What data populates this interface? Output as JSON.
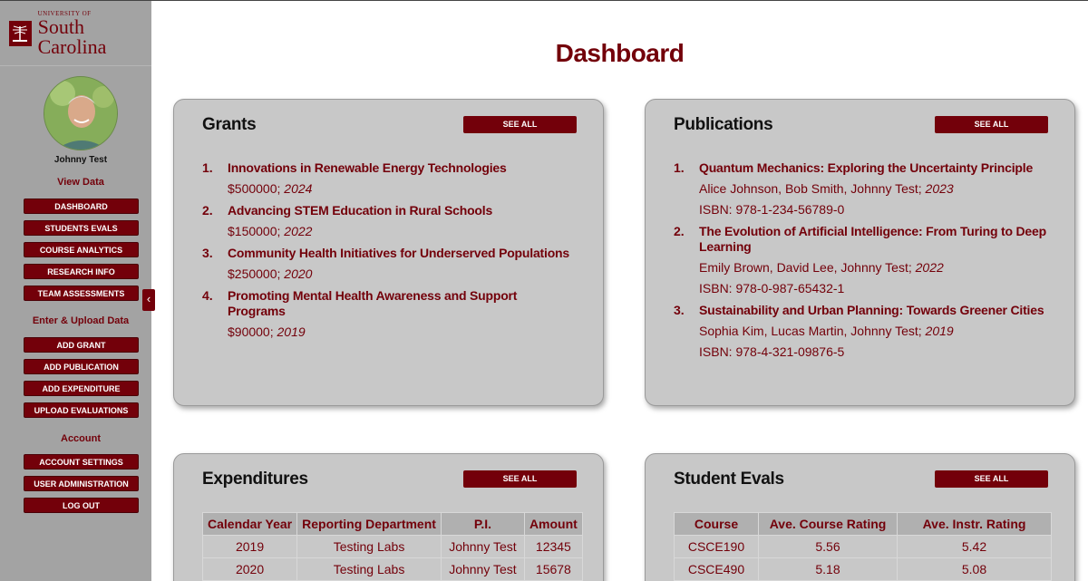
{
  "brand": {
    "sub": "UNIVERSITY OF",
    "main": "South Carolina"
  },
  "user": {
    "name": "Johnny Test"
  },
  "sidebar": {
    "view_data_label": "View Data",
    "view_items": [
      "DASHBOARD",
      "STUDENTS EVALS",
      "COURSE ANALYTICS",
      "RESEARCH INFO",
      "TEAM ASSESSMENTS"
    ],
    "enter_label": "Enter & Upload Data",
    "enter_items": [
      "ADD GRANT",
      "ADD PUBLICATION",
      "ADD EXPENDITURE",
      "UPLOAD EVALUATIONS"
    ],
    "account_label": "Account",
    "account_items": [
      "ACCOUNT SETTINGS",
      "USER ADMINISTRATION",
      "LOG OUT"
    ],
    "collapse_glyph": "‹"
  },
  "page": {
    "title": "Dashboard"
  },
  "see_all": "SEE ALL",
  "grants": {
    "title": "Grants",
    "items": [
      {
        "num": "1.",
        "title": "Innovations in Renewable Energy Technologies",
        "amount": "$500000; ",
        "year": "2024"
      },
      {
        "num": "2.",
        "title": "Advancing STEM Education in Rural Schools",
        "amount": "$150000; ",
        "year": "2022"
      },
      {
        "num": "3.",
        "title": "Community Health Initiatives for Underserved Populations",
        "amount": "$250000; ",
        "year": "2020"
      },
      {
        "num": "4.",
        "title": "Promoting Mental Health Awareness and Support Programs",
        "amount": "$90000; ",
        "year": "2019"
      }
    ]
  },
  "publications": {
    "title": "Publications",
    "items": [
      {
        "num": "1.",
        "title": "Quantum Mechanics: Exploring the Uncertainty Principle",
        "authors": "Alice Johnson, Bob Smith, Johnny Test; ",
        "year": "2023",
        "isbn": "ISBN: 978-1-234-56789-0"
      },
      {
        "num": "2.",
        "title": "The Evolution of Artificial Intelligence: From Turing to Deep Learning",
        "authors": "Emily Brown, David Lee, Johnny Test; ",
        "year": "2022",
        "isbn": "ISBN: 978-0-987-65432-1"
      },
      {
        "num": "3.",
        "title": "Sustainability and Urban Planning: Towards Greener Cities",
        "authors": "Sophia Kim, Lucas Martin, Johnny Test; ",
        "year": "2019",
        "isbn": "ISBN: 978-4-321-09876-5"
      }
    ]
  },
  "expenditures": {
    "title": "Expenditures",
    "headers": [
      "Calendar Year",
      "Reporting Department",
      "P.I.",
      "Amount"
    ],
    "rows": [
      [
        "2019",
        "Testing Labs",
        "Johnny Test",
        "12345"
      ],
      [
        "2020",
        "Testing Labs",
        "Johnny Test",
        "15678"
      ]
    ]
  },
  "student_evals": {
    "title": "Student Evals",
    "headers": [
      "Course",
      "Ave. Course Rating",
      "Ave. Instr. Rating"
    ],
    "rows": [
      [
        "CSCE190",
        "5.56",
        "5.42"
      ],
      [
        "CSCE490",
        "5.18",
        "5.08"
      ]
    ]
  },
  "colors": {
    "garnet": "#73000a",
    "sidebar": "#a3a3a3",
    "card": "#c8c8c8"
  }
}
